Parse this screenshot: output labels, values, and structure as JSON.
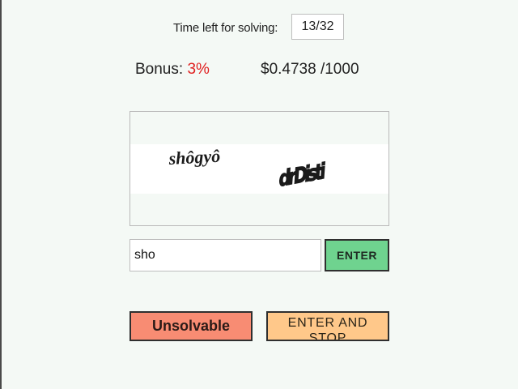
{
  "timer": {
    "label": "Time left for solving:",
    "value": "13/32"
  },
  "stats": {
    "bonus_label": "Bonus:",
    "bonus_value": "3%",
    "earnings": "$0.4738 /1000"
  },
  "captcha": {
    "word_1": "shôgyô",
    "word_2": "drDisti"
  },
  "answer": {
    "value": "sho",
    "enter_label": "ENTER"
  },
  "actions": {
    "unsolvable_label": "Unsolvable",
    "enter_and_stop_label": "ENTER AND STOP"
  },
  "colors": {
    "background": "#f4f9f5",
    "bonus": "#e02020",
    "enter": "#6fd38f",
    "unsolvable": "#f88c73",
    "enter_and_stop": "#ffc88a"
  }
}
